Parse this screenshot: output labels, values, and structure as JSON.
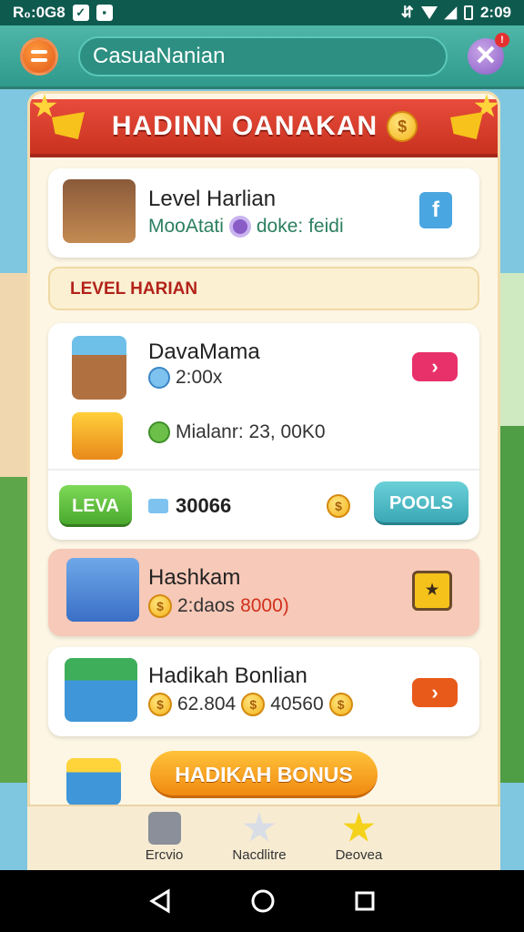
{
  "status_bar": {
    "time_left": "R₀:0G8",
    "time_right": "2:09"
  },
  "top_bar": {
    "search_value": "CasuaNanian"
  },
  "banner": {
    "title": "HADINN OANAKAN"
  },
  "daily_card": {
    "title": "Level Harlian",
    "subtitle_a": "MooAtati",
    "subtitle_b": "doke: feidi"
  },
  "section": {
    "label": "LEVEL HARIAN"
  },
  "dava_card": {
    "title": "DavaMama",
    "value": "2:00x",
    "stat": "Mialanr: 23, 00K0"
  },
  "action_row": {
    "green_button": "LEVA",
    "amount": "30066",
    "teal_button": "POOLS"
  },
  "hash_card": {
    "title": "Hashkam",
    "value": "2:daos",
    "value_red": "8000)"
  },
  "bonus_card": {
    "title": "Hadikah Bonlian",
    "value_a": "62.804",
    "value_b": "40560"
  },
  "bonus_button": {
    "label": "HADIKAH BONUS"
  },
  "bottom_nav": [
    {
      "label": "Ercvio"
    },
    {
      "label": "Nacdlitre"
    },
    {
      "label": "Deovea"
    }
  ],
  "colors": {
    "accent_red": "#e84c3c",
    "teal": "#2f9a8c",
    "orange": "#f08a10"
  }
}
